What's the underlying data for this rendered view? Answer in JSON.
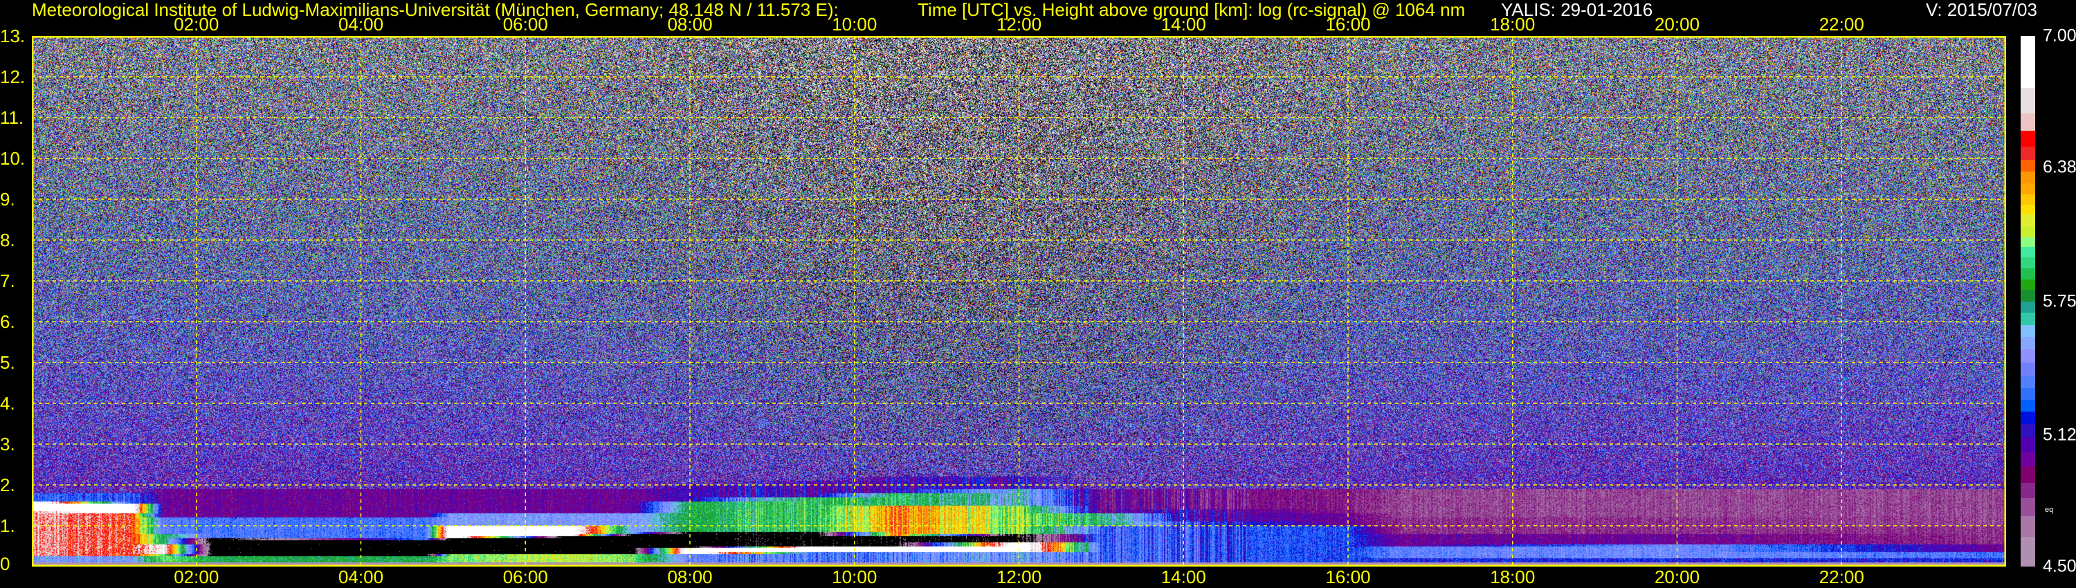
{
  "header": {
    "institute": "Meteorological Institute of Ludwig-Maximilians-Universität (München, Germany; 48.148 N / 11.573 E):",
    "description": "Time [UTC] vs. Height above ground [km]: log (rc-signal) @ 1064 nm",
    "station_date": "YALIS: 29-01-2016",
    "version": "V: 2015/07/03"
  },
  "chart_data": {
    "type": "heatmap",
    "title": "Time [UTC] vs. Height above ground [km]: log (rc-signal) @ 1064 nm",
    "xlabel": "Time [UTC]",
    "ylabel": "Height above ground [km]",
    "xlim_hours": [
      0,
      24
    ],
    "ylim_km": [
      0,
      13
    ],
    "x_ticks": [
      {
        "hour": 2,
        "label": "02:00"
      },
      {
        "hour": 4,
        "label": "04:00"
      },
      {
        "hour": 6,
        "label": "06:00"
      },
      {
        "hour": 8,
        "label": "08:00"
      },
      {
        "hour": 10,
        "label": "10:00"
      },
      {
        "hour": 12,
        "label": "12:00"
      },
      {
        "hour": 14,
        "label": "14:00"
      },
      {
        "hour": 16,
        "label": "16:00"
      },
      {
        "hour": 18,
        "label": "18:00"
      },
      {
        "hour": 20,
        "label": "20:00"
      },
      {
        "hour": 22,
        "label": "22:00"
      }
    ],
    "y_ticks": [
      {
        "km": 13,
        "label": "13."
      },
      {
        "km": 12,
        "label": "12."
      },
      {
        "km": 11,
        "label": "11."
      },
      {
        "km": 10,
        "label": "10."
      },
      {
        "km": 9,
        "label": "9."
      },
      {
        "km": 8,
        "label": "8."
      },
      {
        "km": 7,
        "label": "7."
      },
      {
        "km": 6,
        "label": "6."
      },
      {
        "km": 5,
        "label": "5."
      },
      {
        "km": 4,
        "label": "4."
      },
      {
        "km": 3,
        "label": "3."
      },
      {
        "km": 2,
        "label": "2."
      },
      {
        "km": 1,
        "label": "1."
      },
      {
        "km": 0,
        "label": "0"
      }
    ],
    "grid": true,
    "colorbar": {
      "range": [
        4.5,
        7.0
      ],
      "ticks": [
        {
          "value": 7.0,
          "label": "7.00"
        },
        {
          "value": 6.38,
          "label": "6.38"
        },
        {
          "value": 5.75,
          "label": "5.75"
        },
        {
          "value": 5.12,
          "label": "5.12"
        },
        {
          "value": 4.5,
          "label": "4.50"
        }
      ],
      "note": "eq",
      "colors_top_to_bottom": [
        "#ffffff",
        "#e8e0e0",
        "#ecc4c4",
        "#ff0000",
        "#ee2828",
        "#ff6000",
        "#ff9800",
        "#ffa800",
        "#ffc800",
        "#ffe000",
        "#e0f030",
        "#c8f030",
        "#8cff80",
        "#40e8a0",
        "#30d880",
        "#20c050",
        "#20a810",
        "#189030",
        "#20a090",
        "#30c8a8",
        "#80c0ff",
        "#88a8ff",
        "#9090ff",
        "#7080ff",
        "#5080ff",
        "#3070ff",
        "#0060ff",
        "#0010e0",
        "#3010c0",
        "#5000b0",
        "#7000a0",
        "#800070",
        "#882888",
        "#985098",
        "#a878a8",
        "#b090b0"
      ],
      "below_range_color": "#000000"
    },
    "profile_keyframes_note": "approximate layer structure: [top_km, log signal] from ground up",
    "profile_keyframes": [
      {
        "hour": 0.0,
        "layers": [
          [
            0.1,
            4.55
          ],
          [
            0.25,
            5.5
          ],
          [
            1.35,
            6.6
          ],
          [
            1.6,
            7.1
          ],
          [
            1.8,
            5.3
          ]
        ]
      },
      {
        "hour": 1.2,
        "layers": [
          [
            0.1,
            4.55
          ],
          [
            0.25,
            5.5
          ],
          [
            1.3,
            6.5
          ],
          [
            1.55,
            7.1
          ],
          [
            1.8,
            5.3
          ]
        ]
      },
      {
        "hour": 1.6,
        "layers": [
          [
            0.1,
            4.55
          ],
          [
            0.3,
            6.0
          ],
          [
            0.55,
            6.8
          ],
          [
            0.8,
            5.8
          ],
          [
            1.2,
            5.4
          ],
          [
            1.9,
            5.0
          ]
        ]
      },
      {
        "hour": 2.2,
        "layers": [
          [
            0.1,
            4.55
          ],
          [
            0.25,
            5.8
          ],
          [
            0.7,
            4.3
          ],
          [
            1.2,
            5.35
          ],
          [
            1.9,
            5.0
          ]
        ]
      },
      {
        "hour": 4.8,
        "layers": [
          [
            0.1,
            4.55
          ],
          [
            0.25,
            5.8
          ],
          [
            0.65,
            4.3
          ],
          [
            1.2,
            5.35
          ],
          [
            1.9,
            5.0
          ]
        ]
      },
      {
        "hour": 5.1,
        "layers": [
          [
            0.1,
            4.55
          ],
          [
            0.3,
            6.0
          ],
          [
            0.7,
            4.3
          ],
          [
            1.0,
            7.1
          ],
          [
            1.3,
            5.5
          ],
          [
            1.9,
            5.0
          ]
        ]
      },
      {
        "hour": 6.5,
        "layers": [
          [
            0.1,
            4.55
          ],
          [
            0.3,
            6.1
          ],
          [
            0.75,
            4.3
          ],
          [
            1.0,
            7.1
          ],
          [
            1.3,
            5.5
          ],
          [
            1.9,
            5.0
          ]
        ]
      },
      {
        "hour": 7.3,
        "layers": [
          [
            0.1,
            4.55
          ],
          [
            0.3,
            6.0
          ],
          [
            0.8,
            4.3
          ],
          [
            1.3,
            5.5
          ],
          [
            1.9,
            5.0
          ]
        ]
      },
      {
        "hour": 8.0,
        "layers": [
          [
            0.1,
            4.55
          ],
          [
            0.3,
            5.4
          ],
          [
            0.45,
            7.1
          ],
          [
            0.85,
            4.3
          ],
          [
            1.6,
            5.8
          ],
          [
            2.0,
            5.1
          ]
        ]
      },
      {
        "hour": 9.5,
        "layers": [
          [
            0.1,
            4.55
          ],
          [
            0.35,
            5.4
          ],
          [
            0.5,
            7.1
          ],
          [
            0.85,
            4.3
          ],
          [
            1.7,
            5.9
          ],
          [
            2.1,
            5.1
          ]
        ]
      },
      {
        "hour": 10.5,
        "layers": [
          [
            0.1,
            4.55
          ],
          [
            0.35,
            5.4
          ],
          [
            0.5,
            7.1
          ],
          [
            0.75,
            4.3
          ],
          [
            1.5,
            6.35
          ],
          [
            1.8,
            5.85
          ],
          [
            2.2,
            5.1
          ]
        ]
      },
      {
        "hour": 12.0,
        "layers": [
          [
            0.1,
            4.55
          ],
          [
            0.35,
            5.5
          ],
          [
            0.6,
            7.1
          ],
          [
            0.8,
            4.3
          ],
          [
            1.5,
            6.0
          ],
          [
            1.9,
            5.6
          ],
          [
            2.2,
            5.1
          ]
        ]
      },
      {
        "hour": 13.0,
        "layers": [
          [
            0.1,
            4.55
          ],
          [
            1.0,
            5.35
          ],
          [
            1.3,
            5.8
          ],
          [
            1.9,
            5.0
          ]
        ]
      },
      {
        "hour": 14.0,
        "layers": [
          [
            0.1,
            4.55
          ],
          [
            1.1,
            5.3
          ],
          [
            1.4,
            5.1
          ],
          [
            1.9,
            4.95
          ]
        ]
      },
      {
        "hour": 16.0,
        "layers": [
          [
            0.1,
            4.55
          ],
          [
            1.0,
            5.25
          ],
          [
            1.3,
            5.0
          ],
          [
            1.9,
            4.9
          ]
        ]
      },
      {
        "hour": 16.6,
        "layers": [
          [
            0.1,
            4.55
          ],
          [
            0.2,
            5.2
          ],
          [
            0.5,
            5.4
          ],
          [
            0.8,
            5.0
          ],
          [
            1.2,
            4.85
          ],
          [
            1.9,
            4.8
          ]
        ]
      },
      {
        "hour": 20.0,
        "layers": [
          [
            0.1,
            4.55
          ],
          [
            0.2,
            5.2
          ],
          [
            0.55,
            5.45
          ],
          [
            0.8,
            5.0
          ],
          [
            1.2,
            4.85
          ],
          [
            1.9,
            4.8
          ]
        ]
      },
      {
        "hour": 24.0,
        "layers": [
          [
            0.1,
            4.55
          ],
          [
            0.2,
            5.2
          ],
          [
            0.35,
            5.35
          ],
          [
            0.55,
            5.0
          ],
          [
            1.0,
            4.85
          ],
          [
            1.9,
            4.8
          ]
        ]
      }
    ]
  }
}
